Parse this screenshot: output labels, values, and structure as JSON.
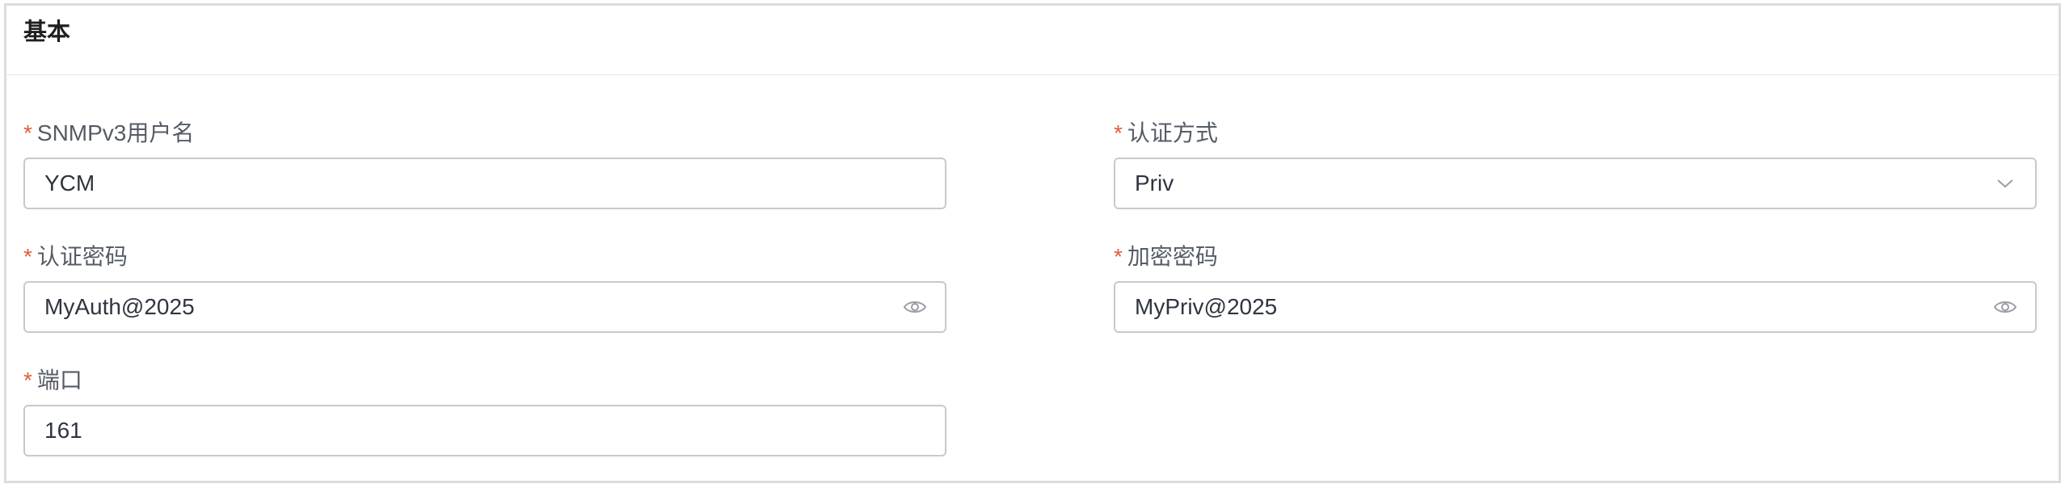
{
  "section": {
    "title": "基本"
  },
  "fields": {
    "username": {
      "label": "SNMPv3用户名",
      "value": "YCM",
      "required": "*"
    },
    "auth_method": {
      "label": "认证方式",
      "value": "Priv",
      "required": "*",
      "icon": "chevron-down-icon"
    },
    "auth_password": {
      "label": "认证密码",
      "value": "MyAuth@2025",
      "required": "*",
      "icon": "eye-icon"
    },
    "priv_password": {
      "label": "加密密码",
      "value": "MyPriv@2025",
      "required": "*",
      "icon": "eye-icon"
    },
    "port": {
      "label": "端口",
      "value": "161",
      "required": "*"
    }
  },
  "colors": {
    "required_mark": "#e05b3a",
    "label_text": "#555c66",
    "input_border": "#c7c9ce",
    "input_text": "#2f3540"
  }
}
